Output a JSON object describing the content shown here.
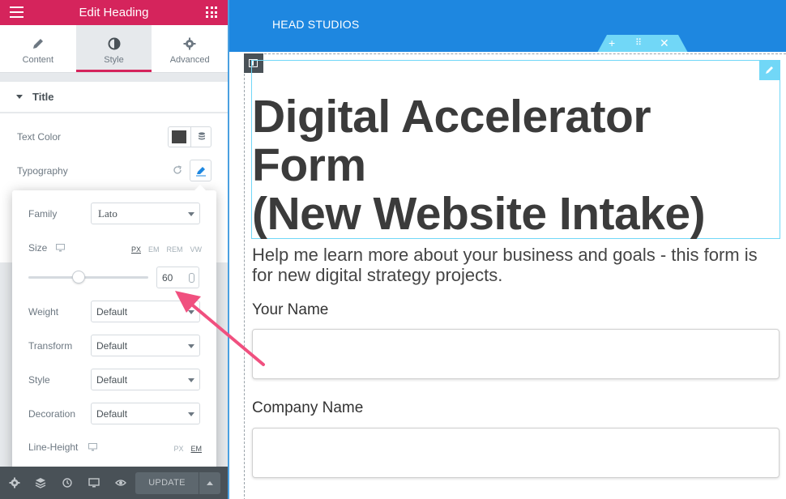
{
  "panel": {
    "header_title": "Edit Heading",
    "tabs": [
      {
        "label": "Content",
        "icon": "pencil-icon"
      },
      {
        "label": "Style",
        "icon": "contrast-icon"
      },
      {
        "label": "Advanced",
        "icon": "gear-icon"
      }
    ],
    "active_tab": "Style",
    "section_title": "Title",
    "text_color_label": "Text Color",
    "text_color_value": "#444444",
    "typography_label": "Typography",
    "typography": {
      "family_label": "Family",
      "family_value": "Lato",
      "size_label": "Size",
      "size_units": [
        "PX",
        "EM",
        "REM",
        "VW"
      ],
      "size_unit_selected": "PX",
      "size_value": "60",
      "weight_label": "Weight",
      "weight_value": "Default",
      "transform_label": "Transform",
      "transform_value": "Default",
      "style_label": "Style",
      "style_value": "Default",
      "decoration_label": "Decoration",
      "decoration_value": "Default",
      "line_height_label": "Line-Height",
      "line_height_units": [
        "PX",
        "EM"
      ],
      "line_height_unit_selected": "EM"
    },
    "update_label": "UPDATE"
  },
  "preview": {
    "site_name": "HEAD STUDIOS",
    "heading_lines": [
      "Digital Accelerator",
      "Form",
      "(New Website Intake)"
    ],
    "subtext": "Help me learn more about your business and goals - this form is for new digital strategy projects.",
    "fields": [
      {
        "label": "Your Name",
        "value": ""
      },
      {
        "label": "Company Name",
        "value": ""
      }
    ]
  },
  "colors": {
    "accent": "#d5245c",
    "topbar": "#1e87e0",
    "handle": "#71d7f7",
    "annotation_arrow": "#f0507f"
  }
}
